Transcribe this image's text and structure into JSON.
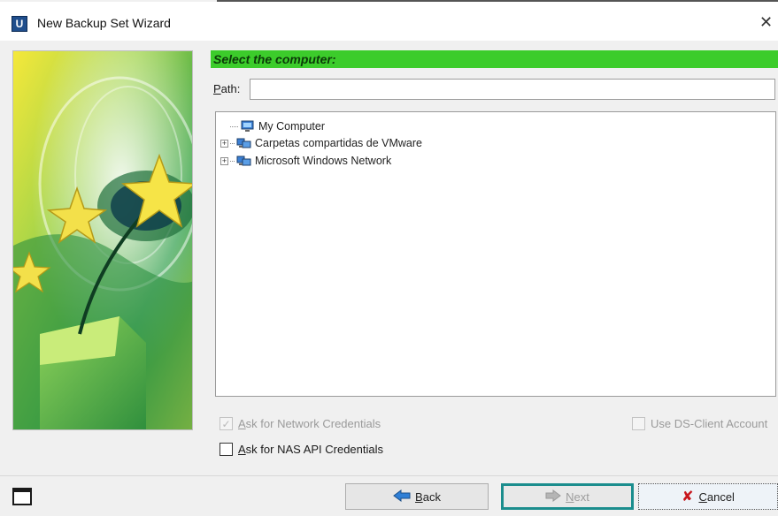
{
  "window": {
    "title": "New Backup Set Wizard",
    "app_icon_letter": "U"
  },
  "section": {
    "header": "Select the computer:"
  },
  "path": {
    "label_prefix": "",
    "label_accel": "P",
    "label_rest": "ath:",
    "value": ""
  },
  "tree": {
    "items": [
      {
        "label": "My Computer",
        "expander": "none"
      },
      {
        "label": "Carpetas compartidas de VMware",
        "expander": "plus"
      },
      {
        "label": "Microsoft Windows Network",
        "expander": "plus"
      }
    ]
  },
  "options": {
    "ask_network_credentials": {
      "label_accel": "A",
      "label_rest": "sk for Network Credentials",
      "checked": true,
      "enabled": false
    },
    "use_ds_client_account": {
      "label": "Use DS-Client Account",
      "checked": false,
      "enabled": false
    },
    "ask_nas_credentials": {
      "label_accel": "A",
      "label_rest": "sk for NAS API Credentials",
      "checked": false,
      "enabled": true
    }
  },
  "buttons": {
    "back": {
      "accel": "B",
      "rest": "ack"
    },
    "next": {
      "accel": "N",
      "rest": "ext"
    },
    "cancel": {
      "accel": "C",
      "rest": "ancel"
    }
  },
  "colors": {
    "header_green": "#3ccc2b",
    "focus_teal": "#1b8d8d"
  }
}
